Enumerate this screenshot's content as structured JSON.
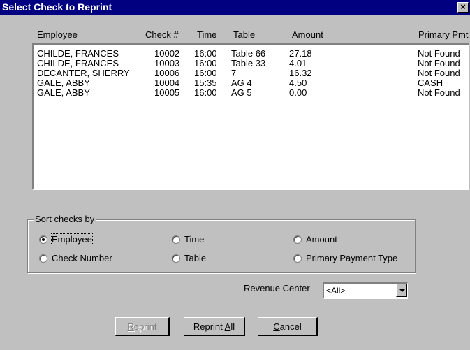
{
  "window": {
    "title": "Select Check to Reprint",
    "close_glyph": "×"
  },
  "list": {
    "headers": [
      "Employee",
      "Check #",
      "Time",
      "Table",
      "Amount",
      "Primary Pmt"
    ],
    "rows": [
      [
        "CHILDE, FRANCES",
        "10002",
        "16:00",
        "Table 66",
        "27.18",
        "Not Found"
      ],
      [
        "CHILDE, FRANCES",
        "10003",
        "16:00",
        "Table 33",
        "4.01",
        "Not Found"
      ],
      [
        "DECANTER, SHERRY",
        "10006",
        "16:00",
        "7",
        "16.32",
        "Not Found"
      ],
      [
        "GALE, ABBY",
        "10004",
        "15:35",
        "AG 4",
        "4.50",
        "CASH"
      ],
      [
        "GALE, ABBY",
        "10005",
        "16:00",
        "AG 5",
        "0.00",
        "Not Found"
      ]
    ]
  },
  "sort": {
    "legend": "Sort checks by",
    "options": [
      {
        "label": "Employee",
        "selected": true
      },
      {
        "label": "Time",
        "selected": false
      },
      {
        "label": "Amount",
        "selected": false
      },
      {
        "label": "Check Number",
        "selected": false
      },
      {
        "label": "Table",
        "selected": false
      },
      {
        "label": "Primary Payment Type",
        "selected": false
      }
    ]
  },
  "revenue": {
    "label": "Revenue Center",
    "value": "<All>"
  },
  "buttons": {
    "reprint": {
      "label": "Reprint",
      "enabled": false
    },
    "reprint_all": {
      "label": "Reprint All",
      "mnemonic": "A"
    },
    "cancel": {
      "label": "Cancel",
      "mnemonic": "C"
    }
  }
}
